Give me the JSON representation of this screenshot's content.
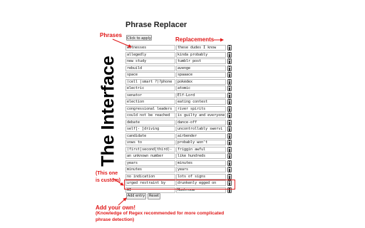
{
  "page_title": "Phrase Replacer",
  "apply_button": "Click to apply",
  "rows": [
    {
      "phrase": "witnesses",
      "replacement": "these dudes I know"
    },
    {
      "phrase": "allegedly",
      "replacement": "kinda probably"
    },
    {
      "phrase": "new study",
      "replacement": "tumblr post"
    },
    {
      "phrase": "rebuild",
      "replacement": "avenge"
    },
    {
      "phrase": "space",
      "replacement": "spaaace"
    },
    {
      "phrase": "(cell |smart ?)?phone",
      "replacement": "pokédex"
    },
    {
      "phrase": "electric",
      "replacement": "atomic"
    },
    {
      "phrase": "senator",
      "replacement": "Elf-Lord"
    },
    {
      "phrase": "election",
      "replacement": "eating contest"
    },
    {
      "phrase": "congressional leaders",
      "replacement": "river spirits"
    },
    {
      "phrase": "could not be reached",
      "replacement": "is guilty and everyone"
    },
    {
      "phrase": "debate",
      "replacement": "dance-off"
    },
    {
      "phrase": "self[- ]driving",
      "replacement": "uncontrollably swervi"
    },
    {
      "phrase": "candidate",
      "replacement": "airbender"
    },
    {
      "phrase": "vows to",
      "replacement": "probably won't"
    },
    {
      "phrase": "(first|second|third)-",
      "replacement": "friggin awful"
    },
    {
      "phrase": "an unknown number",
      "replacement": "like hundreds"
    },
    {
      "phrase": "years",
      "replacement": "minutes"
    },
    {
      "phrase": "minutes",
      "replacement": "years"
    },
    {
      "phrase": "no indication",
      "replacement": "lots of signs"
    },
    {
      "phrase": "urged restraint by",
      "replacement": "drunkenly egged on"
    },
    {
      "phrase": "AI",
      "replacement": "Mushroom"
    }
  ],
  "add_entry_button": "Add entry",
  "reset_button": "Reset",
  "annotations": {
    "phrases": "Phrases",
    "replacements": "Replacements",
    "the_interface": "The Interface",
    "custom_line1": "(This one",
    "custom_line2": "is custom)",
    "add_your_own": "Add your own!",
    "knowledge_line1": "(Knowledge of Regex recommended for more complicated",
    "knowledge_line2": "phrase detection)"
  },
  "colors": {
    "annotation_red": "#e01818",
    "border_gray": "#bdbdbd"
  },
  "icons": [
    "trash-icon"
  ]
}
